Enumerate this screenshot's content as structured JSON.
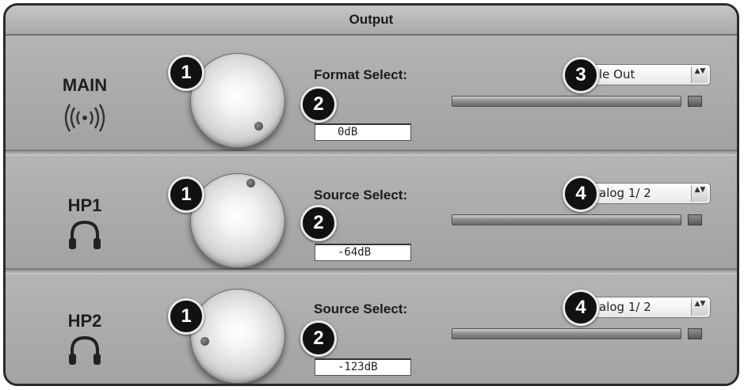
{
  "window": {
    "title": "Output"
  },
  "channels": [
    {
      "name": "MAIN",
      "icon": "speaker-waves-icon",
      "knob_badge": "1",
      "select_label": "Format Select:",
      "level_badge": "2",
      "level_value": "0dB",
      "dropdown_badge": "3",
      "dropdown_value": "le Out"
    },
    {
      "name": "HP1",
      "icon": "headphones-icon",
      "knob_badge": "1",
      "select_label": "Source Select:",
      "level_badge": "2",
      "level_value": "-64dB",
      "dropdown_badge": "4",
      "dropdown_value": "alog 1/ 2"
    },
    {
      "name": "HP2",
      "icon": "headphones-icon",
      "knob_badge": "1",
      "select_label": "Source Select:",
      "level_badge": "2",
      "level_value": "-123dB",
      "dropdown_badge": "4",
      "dropdown_value": "alog 1/ 2"
    }
  ],
  "dropdown_arrows": "▲▼"
}
